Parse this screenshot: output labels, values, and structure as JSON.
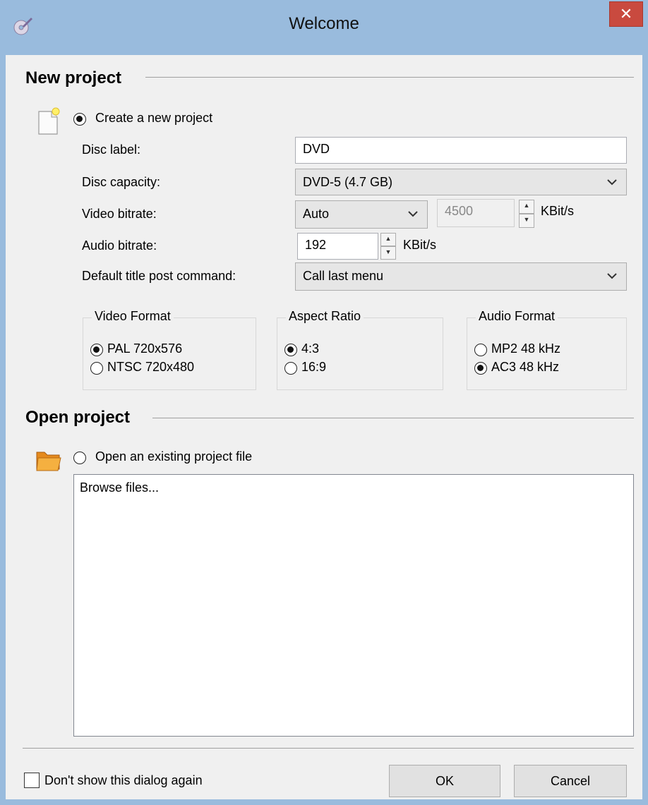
{
  "window": {
    "title": "Welcome",
    "close_glyph": "✕"
  },
  "new_project": {
    "heading": "New project",
    "create_radio_label": "Create a new project",
    "create_selected": true,
    "fields": {
      "disc_label": {
        "label": "Disc label:",
        "value": "DVD"
      },
      "disc_capacity": {
        "label": "Disc capacity:",
        "value": "DVD-5 (4.7 GB)"
      },
      "video_bitrate": {
        "label": "Video bitrate:",
        "mode": "Auto",
        "value": "4500",
        "unit": "KBit/s"
      },
      "audio_bitrate": {
        "label": "Audio bitrate:",
        "value": "192",
        "unit": "KBit/s"
      },
      "post_command": {
        "label": "Default title post command:",
        "value": "Call last menu"
      }
    },
    "video_format": {
      "title": "Video Format",
      "options": [
        "PAL 720x576",
        "NTSC 720x480"
      ],
      "selected": 0
    },
    "aspect_ratio": {
      "title": "Aspect Ratio",
      "options": [
        "4:3",
        "16:9"
      ],
      "selected": 0
    },
    "audio_format": {
      "title": "Audio Format",
      "options": [
        "MP2 48 kHz",
        "AC3 48 kHz"
      ],
      "selected": 1
    }
  },
  "open_project": {
    "heading": "Open project",
    "open_radio_label": "Open an existing project file",
    "files": [
      "Browse files..."
    ]
  },
  "footer": {
    "dont_show_label": "Don't show this dialog again",
    "ok_label": "OK",
    "cancel_label": "Cancel"
  },
  "icons": {
    "app": "dvd-pen-icon",
    "new_doc": "new-document-icon",
    "folder": "folder-icon",
    "chevron": "chevron-down-icon"
  },
  "colors": {
    "titlebar": "#99bbdd",
    "close": "#c94a3f",
    "client": "#f0f0f0"
  }
}
